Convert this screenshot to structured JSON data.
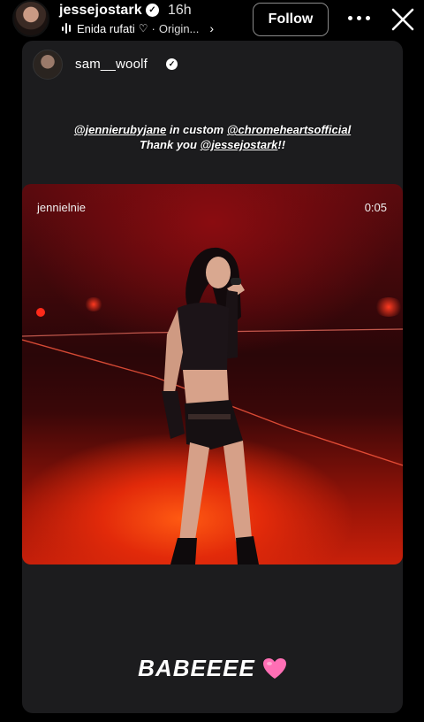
{
  "header": {
    "owner_username": "jessejostark",
    "verified_mark": "✓",
    "time": "16h",
    "audio_artist": "Enida rufati",
    "audio_source": "Origin...",
    "follow_label": "Follow"
  },
  "story": {
    "repost_username": "sam__woolf",
    "verified_mark": "✓",
    "caption": {
      "line1_mention1": "@jennierubyjane",
      "line1_text": " in custom ",
      "line1_mention2": "@chromeheartsofficial",
      "line2_text": "Thank you ",
      "line2_mention": "@jessejostark",
      "line2_suffix": "!!"
    },
    "video": {
      "username": "jennielnie",
      "timestamp": "0:05"
    },
    "bottom_text": "BABEEEE"
  },
  "icons": {
    "audio": "audio-waveform-icon",
    "heart_outline": "heart-outline-icon",
    "chevron": "chevron-right-icon",
    "more": "more-options-icon",
    "close": "close-icon",
    "pink_heart": "pink-heart-emoji"
  },
  "colors": {
    "background": "#000000",
    "card": "#1c1c1e",
    "stage_red": "#c8200a",
    "heart_pink": "#ff6fb5"
  }
}
